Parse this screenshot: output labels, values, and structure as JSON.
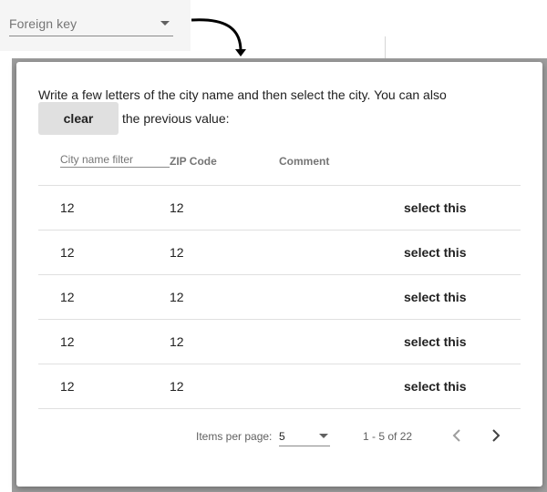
{
  "foreign_key": {
    "label": "Foreign key",
    "icon": "chevron-down-icon"
  },
  "dialog": {
    "intro_text": "Write a few letters of the city name and then select the city. You can also",
    "clear_label": "clear",
    "after_clear_text": "the previous value:",
    "table": {
      "filter_placeholder": "City name filter",
      "columns": {
        "zip": "ZIP Code",
        "comment": "Comment"
      },
      "rows": [
        {
          "city": "12",
          "zip": "12",
          "comment": "",
          "action": "select this"
        },
        {
          "city": "12",
          "zip": "12",
          "comment": "",
          "action": "select this"
        },
        {
          "city": "12",
          "zip": "12",
          "comment": "",
          "action": "select this"
        },
        {
          "city": "12",
          "zip": "12",
          "comment": "",
          "action": "select this"
        },
        {
          "city": "12",
          "zip": "12",
          "comment": "",
          "action": "select this"
        }
      ]
    },
    "paginator": {
      "items_per_page_label": "Items per page:",
      "items_per_page_value": "5",
      "range_label": "1 - 5 of 22",
      "prev_icon": "chevron-left-icon",
      "next_icon": "chevron-right-icon"
    }
  },
  "colors": {
    "backdrop": "#9e9e9e",
    "divider": "#e0e0e0",
    "button_bg": "#e0e0e0"
  }
}
